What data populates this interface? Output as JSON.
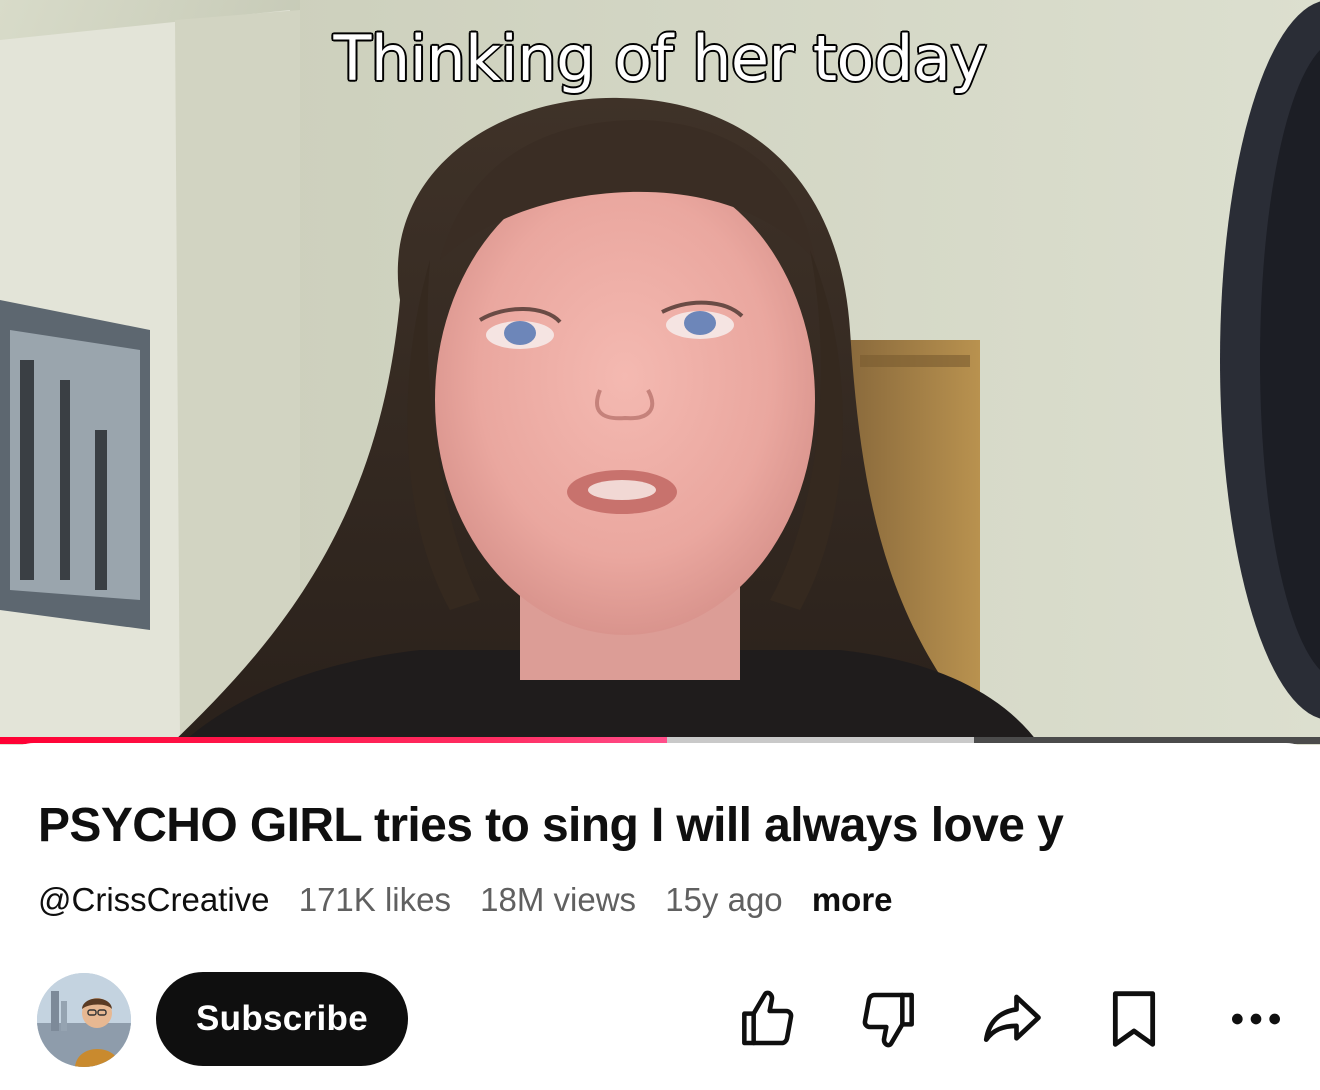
{
  "video": {
    "caption": "Thinking of her today",
    "progress": {
      "played_fraction": 0.505,
      "buffered_fraction": 0.738
    }
  },
  "info": {
    "title": "PSYCHO GIRL tries to sing I will always love y",
    "channel": "@CrissCreative",
    "likes": "171K likes",
    "views": "18M views",
    "age": "15y ago",
    "more_label": "more"
  },
  "actions": {
    "subscribe_label": "Subscribe",
    "icons": [
      "like-icon",
      "dislike-icon",
      "share-icon",
      "save-icon",
      "more-options-icon"
    ]
  },
  "colors": {
    "progress_played": "#ff0033",
    "progress_buffered": "#c9c9c9",
    "subscribe_bg": "#0f0f0f",
    "text_primary": "#0f0f0f",
    "text_secondary": "#606060"
  }
}
